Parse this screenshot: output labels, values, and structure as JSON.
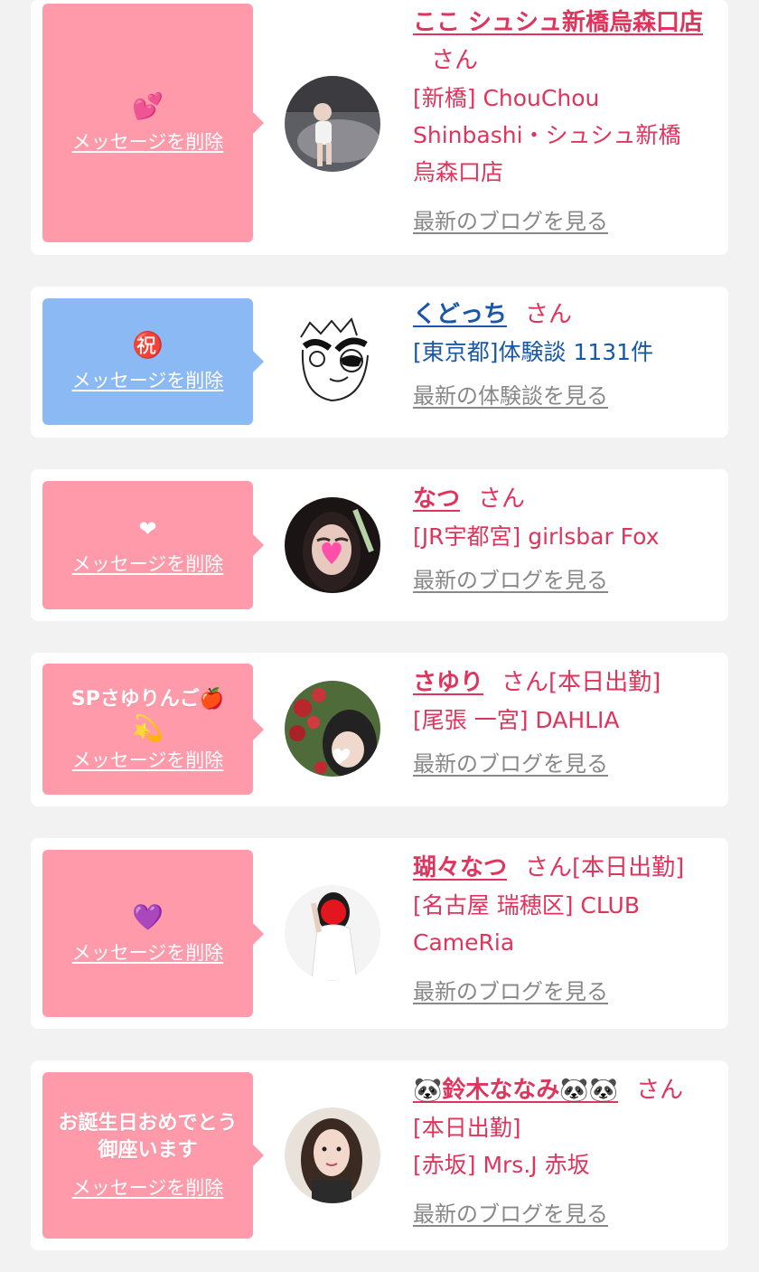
{
  "cards": [
    {
      "emoji": "💕",
      "message": "",
      "delete_label": "メッセージを削除",
      "name": "ここ シュシュ新橋烏森口店",
      "suffix": "さん",
      "shop_lines": [
        "[新橋] ChouChou",
        "Shinbashi・シュシュ新橋",
        "烏森口店"
      ],
      "link": "最新のブログを見る"
    },
    {
      "emoji": "㊗️",
      "message": "",
      "delete_label": "メッセージを削除",
      "name": "くどっち",
      "suffix": "さん",
      "shop_lines": [
        "[東京都]体験談 1131件"
      ],
      "link": "最新の体験談を見る"
    },
    {
      "emoji": "❤",
      "message": "",
      "delete_label": "メッセージを削除",
      "name": "なつ",
      "suffix": "さん",
      "shop_lines": [
        "[JR宇都宮] girlsbar Fox"
      ],
      "link": "最新のブログを見る"
    },
    {
      "emoji": "💫",
      "message": "SPさゆりんご🍎",
      "delete_label": "メッセージを削除",
      "name": "さゆり",
      "suffix": "さん[本日出勤]",
      "shop_lines": [
        "[尾張 一宮] DAHLIA"
      ],
      "link": "最新のブログを見る"
    },
    {
      "emoji": "💜",
      "message": "",
      "delete_label": "メッセージを削除",
      "name": "瑚々なつ",
      "suffix": "さん[本日出勤]",
      "shop_lines": [
        "[名古屋 瑞穂区] CLUB",
        "CameRia"
      ],
      "link": "最新のブログを見る"
    },
    {
      "emoji": "",
      "message": "お誕生日おめでとう御座います",
      "delete_label": "メッセージを削除",
      "name": "🐼鈴木ななみ🐼🐼",
      "suffix": "さん",
      "shop_lines": [
        "[本日出勤]",
        "[赤坂] Mrs.J 赤坂"
      ],
      "link": "最新のブログを見る"
    }
  ],
  "colors": {
    "bubble_pink": "#fe9aaa",
    "bubble_blue": "#8ab9f4",
    "name_pink": "#e0345c",
    "name_blue": "#1958a8",
    "link_gray": "#888888"
  }
}
